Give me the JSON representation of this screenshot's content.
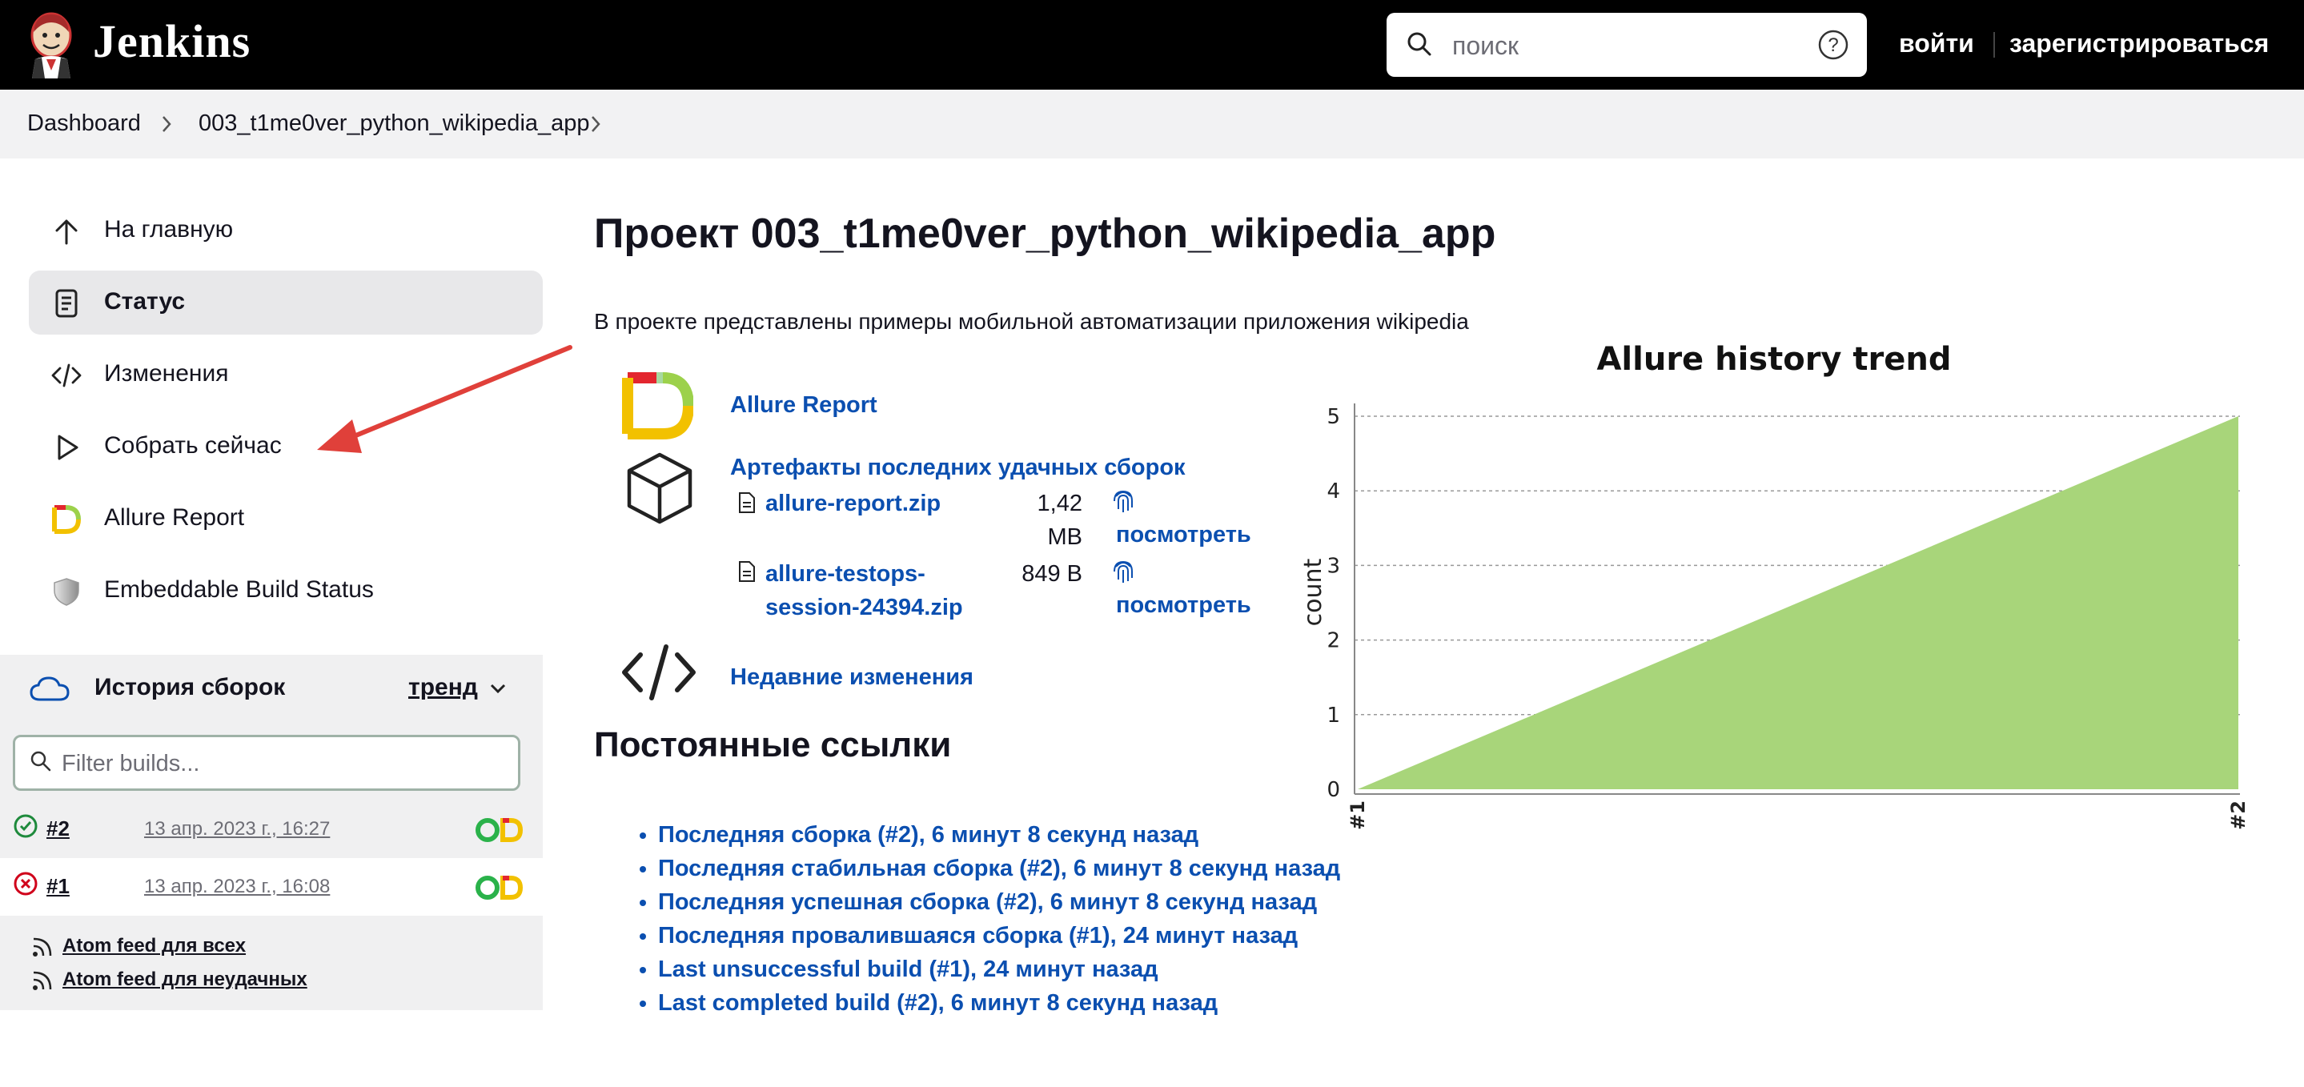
{
  "header": {
    "brand": "Jenkins",
    "search_placeholder": "поиск",
    "login": "войти",
    "register": "зарегистрироваться"
  },
  "breadcrumb": [
    "Dashboard",
    "003_t1me0ver_python_wikipedia_app"
  ],
  "sidebar": {
    "items": [
      {
        "label": "На главную",
        "icon": "arrow-up-icon"
      },
      {
        "label": "Статус",
        "icon": "document-icon"
      },
      {
        "label": "Изменения",
        "icon": "code-icon"
      },
      {
        "label": "Собрать сейчас",
        "icon": "play-icon"
      },
      {
        "label": "Allure Report",
        "icon": "allure-icon"
      },
      {
        "label": "Embeddable Build Status",
        "icon": "shield-icon"
      }
    ],
    "history": {
      "title": "История сборок",
      "trend": "тренд",
      "filter_placeholder": "Filter builds...",
      "builds": [
        {
          "number": "#2",
          "date": "13 апр. 2023 г., 16:27",
          "status": "success"
        },
        {
          "number": "#1",
          "date": "13 апр. 2023 г., 16:08",
          "status": "failed"
        }
      ]
    },
    "feeds": [
      "Atom feed для всех",
      "Atom feed для неудачных"
    ]
  },
  "main": {
    "title": "Проект 003_t1me0ver_python_wikipedia_app",
    "description": "В проекте представлены примеры мобильной автоматизации приложения wikipedia",
    "allure_link": "Allure Report",
    "artifacts": {
      "title": "Артефакты последних удачных сборок",
      "files": [
        {
          "name_line1": "allure-report.zip",
          "name_line2": "",
          "size_line1": "1,42",
          "size_line2": "MB",
          "view": "посмотреть"
        },
        {
          "name_line1": "allure-testops-",
          "name_line2": "session-24394.zip",
          "size_line1": "849 B",
          "size_line2": "",
          "view": "посмотреть"
        }
      ]
    },
    "changes_link": "Недавние изменения",
    "permalinks_title": "Постоянные ссылки",
    "permalinks": [
      "Последняя сборка (#2), 6 минут 8 секунд назад",
      "Последняя стабильная сборка (#2), 6 минут 8 секунд назад",
      "Последняя успешная сборка (#2), 6 минут 8 секунд назад",
      "Последняя провалившаяся сборка (#1), 24 минут назад",
      "Last unsuccessful build (#1), 24 минут назад",
      "Last completed build (#2), 6 минут 8 секунд назад"
    ]
  },
  "colors": {
    "header_bg": "#000000",
    "link": "#0b4fb0",
    "chart_fill": "#a8d57a",
    "success": "#1e8a3c",
    "failed": "#d0021b",
    "annotation_arrow": "#e0403a"
  },
  "chart_data": {
    "type": "area",
    "title": "Allure history trend",
    "ylabel": "count",
    "xlabel": "",
    "categories": [
      "#1",
      "#2"
    ],
    "series": [
      {
        "values": [
          0,
          5
        ]
      }
    ],
    "yticks": [
      0,
      1,
      2,
      3,
      4,
      5
    ],
    "ylim": [
      0,
      5
    ],
    "grid": true
  }
}
